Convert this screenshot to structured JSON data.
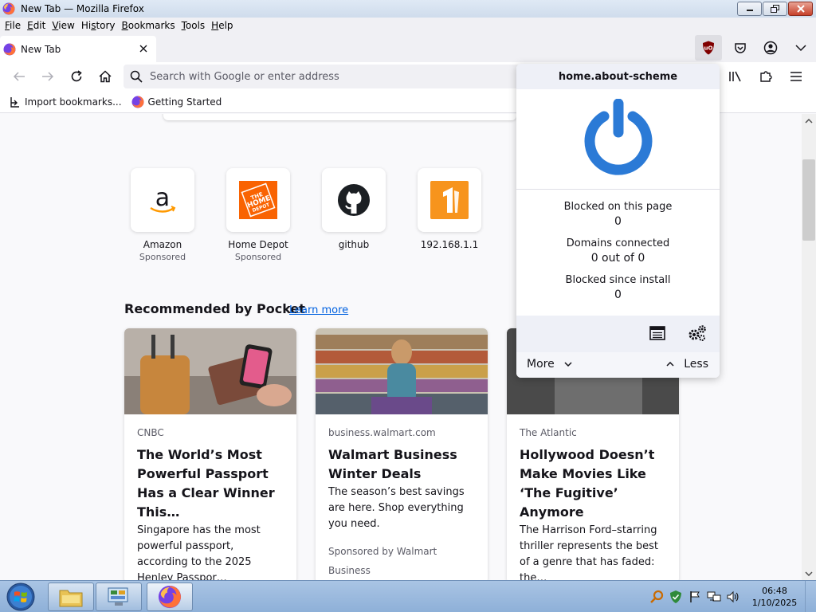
{
  "window": {
    "title": "New Tab — Mozilla Firefox"
  },
  "menubar": {
    "items": [
      {
        "key": "F",
        "rest": "ile"
      },
      {
        "key": "E",
        "rest": "dit"
      },
      {
        "key": "V",
        "rest": "iew"
      },
      {
        "key": "",
        "pre": "Hi",
        "mid": "s",
        "rest": "tory"
      },
      {
        "key": "B",
        "rest": "ookmarks"
      },
      {
        "key": "T",
        "rest": "ools"
      },
      {
        "key": "H",
        "rest": "elp"
      }
    ]
  },
  "tab": {
    "label": "New Tab"
  },
  "urlbar": {
    "placeholder": "Search with Google or enter address"
  },
  "bookmarks": {
    "import": "Import bookmarks...",
    "getting_started": "Getting Started"
  },
  "top_sites": [
    {
      "title": "Amazon",
      "sponsor": "Sponsored",
      "icon": "amazon-logo"
    },
    {
      "title": "Home Depot",
      "sponsor": "Sponsored",
      "icon": "home-depot-logo"
    },
    {
      "title": "github",
      "sponsor": "",
      "icon": "github-logo"
    },
    {
      "title": "192.168.1.1",
      "sponsor": "",
      "icon": "number-one-logo"
    }
  ],
  "pocket": {
    "heading": "Recommended by Pocket",
    "learn_more": "Learn more",
    "cards": [
      {
        "source": "CNBC",
        "title": "The World’s Most Powerful Passport Has a Clear Winner This…",
        "desc": "Singapore has the most powerful passport, according to the 2025 Henley Passpor…",
        "sponsor": ""
      },
      {
        "source": "business.walmart.com",
        "title": "Walmart Business Winter Deals",
        "desc": "The season’s best savings are here. Shop everything you need.",
        "sponsor": "Sponsored by Walmart Business"
      },
      {
        "source": "The Atlantic",
        "title": "Hollywood Doesn’t Make Movies Like ‘The Fugitive’ Anymore",
        "desc": "The Harrison Ford–starring thriller represents the best of a genre that has faded: the…",
        "sponsor": ""
      }
    ]
  },
  "ublock": {
    "hostname": "home.about-scheme",
    "stats": [
      {
        "label": "Blocked on this page",
        "value": "0"
      },
      {
        "label": "Domains connected",
        "value": "0 out of 0"
      },
      {
        "label": "Blocked since install",
        "value": "0"
      }
    ],
    "more": "More",
    "less": "Less",
    "power_color": "#2b7ad6"
  },
  "taskbar": {
    "time": "06:48",
    "date": "1/10/2025"
  },
  "colors": {
    "link": "#0061e0",
    "home_depot": "#f96302",
    "number_one_orange": "#f7941d",
    "ublock_red": "#800000"
  }
}
